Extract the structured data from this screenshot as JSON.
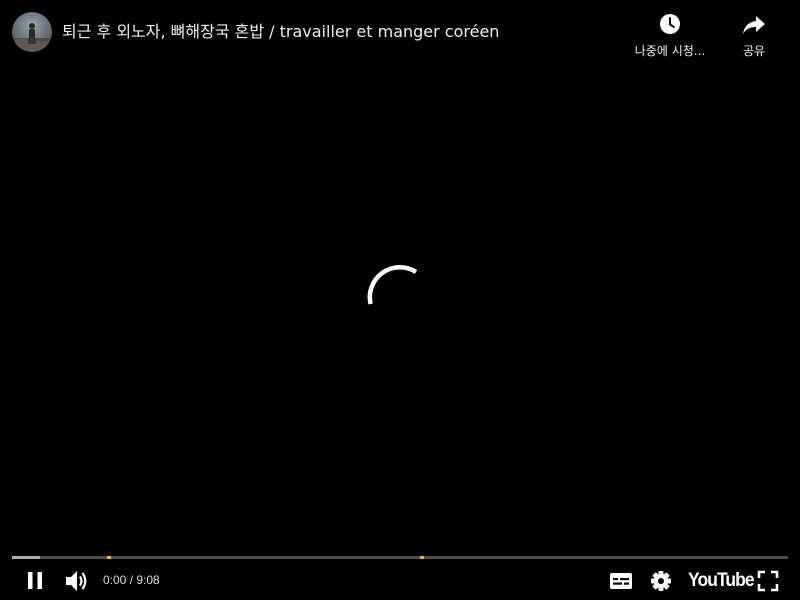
{
  "video": {
    "title": "퇴근 후 외노자, 뼈해장국 혼밥 / travailler et manger coréen",
    "channel_avatar": "avatar"
  },
  "top_actions": {
    "watch_later": {
      "label": "나중에 시청...",
      "icon": "clock-icon"
    },
    "share": {
      "label": "공유",
      "icon": "share-arrow-icon"
    }
  },
  "player": {
    "state": "buffering",
    "spinner_icon": "loading-spinner"
  },
  "progress": {
    "played_fraction": 0.0,
    "loaded_fraction": 0.036,
    "chapter_markers": [
      0.123,
      0.526
    ],
    "marker_color": "#f6b33c"
  },
  "controls": {
    "pause_icon": "pause-icon",
    "volume_icon": "volume-icon",
    "time_current": "0:00",
    "time_separator": " / ",
    "time_duration": "9:08",
    "subtitles_icon": "subtitles-icon",
    "settings_icon": "gear-icon",
    "logo_text": "YouTube",
    "fullscreen_icon": "fullscreen-icon"
  }
}
